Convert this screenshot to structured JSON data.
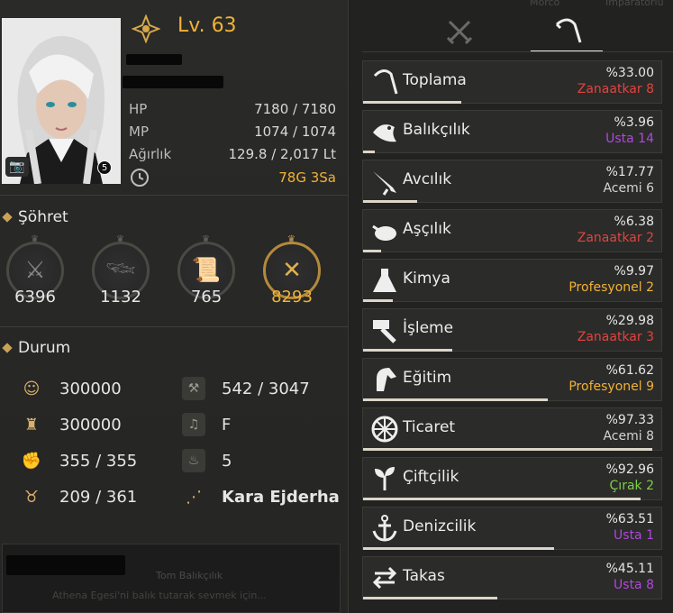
{
  "character": {
    "level_prefix": "Lv.",
    "level": "63",
    "portrait_badge": "5",
    "stats": [
      {
        "label": "HP",
        "value": "7180 / 7180"
      },
      {
        "label": "MP",
        "value": "1074 / 1074"
      },
      {
        "label": "Ağırlık",
        "value": "129.8 / 2,017 Lt"
      }
    ],
    "money": "78G 3Sa"
  },
  "fame": {
    "title": "Şöhret",
    "items": [
      {
        "icon": "swords-icon",
        "value": "6396"
      },
      {
        "icon": "fish-hook-icon",
        "value": "1132"
      },
      {
        "icon": "scroll-icon",
        "value": "765"
      },
      {
        "icon": "crossed-tools-icon",
        "value": "8293"
      }
    ]
  },
  "condition": {
    "title": "Durum",
    "items": [
      {
        "icon": "head-icon",
        "value": "300000"
      },
      {
        "icon": "pickaxe-icon",
        "value": "542 / 3047"
      },
      {
        "icon": "officer-icon",
        "value": "300000"
      },
      {
        "icon": "music-note-icon",
        "value": "F"
      },
      {
        "icon": "arm-icon",
        "value": "355 / 355"
      },
      {
        "icon": "flame-icon",
        "value": "5"
      },
      {
        "icon": "zodiac-icon",
        "value": "209 / 361"
      },
      {
        "icon": "constellation-icon",
        "value": "Kara Ejderha"
      }
    ]
  },
  "note": {
    "line1": "Tom Balıkçılık",
    "line2": "Athena Egesi'ni balık tutarak sevmek için..."
  },
  "right_header": {
    "ghost_left": "Morco",
    "ghost_right": "Imparatorlu"
  },
  "tabs": [
    {
      "icon": "combat-swords-icon",
      "active": false
    },
    {
      "icon": "sickle-icon",
      "active": true
    }
  ],
  "life_skills": [
    {
      "name": "Toplama",
      "pct": "%33.00",
      "rank": "Zanaatkar 8",
      "rank_class": "r-zanaatkar",
      "progress": 0.33,
      "icon": "sickle-icon"
    },
    {
      "name": "Balıkçılık",
      "pct": "%3.96",
      "rank": "Usta 14",
      "rank_class": "r-usta",
      "progress": 0.04,
      "icon": "fish-icon"
    },
    {
      "name": "Avcılık",
      "pct": "%17.77",
      "rank": "Acemi 6",
      "rank_class": "r-acemi",
      "progress": 0.18,
      "icon": "musket-icon"
    },
    {
      "name": "Aşçılık",
      "pct": "%6.38",
      "rank": "Zanaatkar 2",
      "rank_class": "r-zanaatkar",
      "progress": 0.06,
      "icon": "roast-icon"
    },
    {
      "name": "Kimya",
      "pct": "%9.97",
      "rank": "Profesyonel 2",
      "rank_class": "r-prof",
      "progress": 0.1,
      "icon": "flask-icon"
    },
    {
      "name": "İşleme",
      "pct": "%29.98",
      "rank": "Zanaatkar 3",
      "rank_class": "r-zanaatkar",
      "progress": 0.3,
      "icon": "hammer-icon"
    },
    {
      "name": "Eğitim",
      "pct": "%61.62",
      "rank": "Profesyonel 9",
      "rank_class": "r-prof",
      "progress": 0.62,
      "icon": "horse-icon"
    },
    {
      "name": "Ticaret",
      "pct": "%97.33",
      "rank": "Acemi 8",
      "rank_class": "r-acemi",
      "progress": 0.97,
      "icon": "wheel-icon"
    },
    {
      "name": "Çiftçilik",
      "pct": "%92.96",
      "rank": "Çırak 2",
      "rank_class": "r-cirak",
      "progress": 0.93,
      "icon": "sprout-icon"
    },
    {
      "name": "Denizcilik",
      "pct": "%63.51",
      "rank": "Usta 1",
      "rank_class": "r-usta",
      "progress": 0.64,
      "icon": "anchor-icon"
    },
    {
      "name": "Takas",
      "pct": "%45.11",
      "rank": "Usta 8",
      "rank_class": "r-usta",
      "progress": 0.45,
      "icon": "exchange-icon"
    }
  ]
}
